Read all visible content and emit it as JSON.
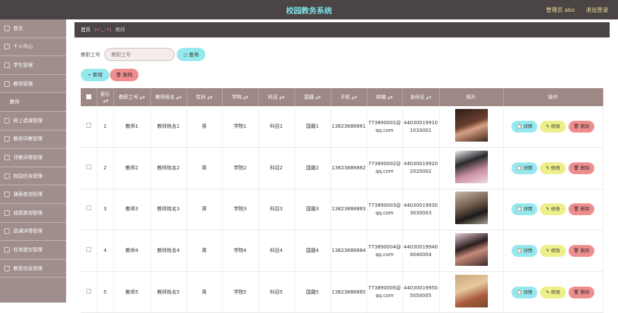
{
  "header": {
    "title": "校园教务系统",
    "user": "管理员 abo",
    "logout": "退出登录"
  },
  "sidebar": {
    "items": [
      {
        "label": "首页",
        "sub": false
      },
      {
        "label": "个人中心",
        "sub": false
      },
      {
        "label": "学生管理",
        "sub": false
      },
      {
        "label": "教师管理",
        "sub": false
      },
      {
        "label": "教师",
        "sub": true
      },
      {
        "label": "网上选课管理",
        "sub": false
      },
      {
        "label": "教师评教管理",
        "sub": false
      },
      {
        "label": "评教详情管理",
        "sub": false
      },
      {
        "label": "校园任务管理",
        "sub": false
      },
      {
        "label": "课表查询管理",
        "sub": false
      },
      {
        "label": "成绩查询管理",
        "sub": false
      },
      {
        "label": "选课详情管理",
        "sub": false
      },
      {
        "label": "任务提交管理",
        "sub": false
      },
      {
        "label": "教室信息管理",
        "sub": false
      }
    ]
  },
  "breadcrumb": {
    "home": "首页",
    "emoticon": "(•'◡'•)",
    "current": "教师"
  },
  "search": {
    "label": "教职工号",
    "placeholder": "教职工号",
    "button": "查询"
  },
  "actions": {
    "add": "新增",
    "delete": "删除"
  },
  "table": {
    "columns": [
      "索引",
      "教职工号",
      "教师姓名",
      "性别",
      "学院",
      "科目",
      "国籍",
      "手机",
      "邮箱",
      "身份证",
      "照片",
      "操作"
    ],
    "rows": [
      {
        "idx": "1",
        "id": "教师1",
        "name": "教师姓名1",
        "gender": "男",
        "college": "学院1",
        "subject": "科目1",
        "nation": "国籍1",
        "phone": "13823888881",
        "email": "773890001@qq.com",
        "idcard": "440300199101010001"
      },
      {
        "idx": "2",
        "id": "教师2",
        "name": "教师姓名2",
        "gender": "男",
        "college": "学院2",
        "subject": "科目2",
        "nation": "国籍2",
        "phone": "13823888882",
        "email": "773890002@qq.com",
        "idcard": "440300199202020002"
      },
      {
        "idx": "3",
        "id": "教师3",
        "name": "教师姓名3",
        "gender": "男",
        "college": "学院3",
        "subject": "科目3",
        "nation": "国籍3",
        "phone": "13823888883",
        "email": "773890003@qq.com",
        "idcard": "440300199303030003"
      },
      {
        "idx": "4",
        "id": "教师4",
        "name": "教师姓名4",
        "gender": "男",
        "college": "学院4",
        "subject": "科目4",
        "nation": "国籍4",
        "phone": "13823888884",
        "email": "773890004@qq.com",
        "idcard": "440300199404040004"
      },
      {
        "idx": "5",
        "id": "教师5",
        "name": "教师姓名5",
        "gender": "男",
        "college": "学院5",
        "subject": "科目5",
        "nation": "国籍5",
        "phone": "13823888885",
        "email": "773890005@qq.com",
        "idcard": "440300199505050005"
      }
    ],
    "row_actions": {
      "detail": "详情",
      "edit": "修改",
      "remove": "删除"
    }
  },
  "colors": {
    "topbar": "#4a4544",
    "sidebar": "#a08e8c",
    "table_header": "#9e8886",
    "accent_cyan": "#94e8ee",
    "accent_yellow": "#ecef8a",
    "accent_red": "#ef8d8d"
  }
}
